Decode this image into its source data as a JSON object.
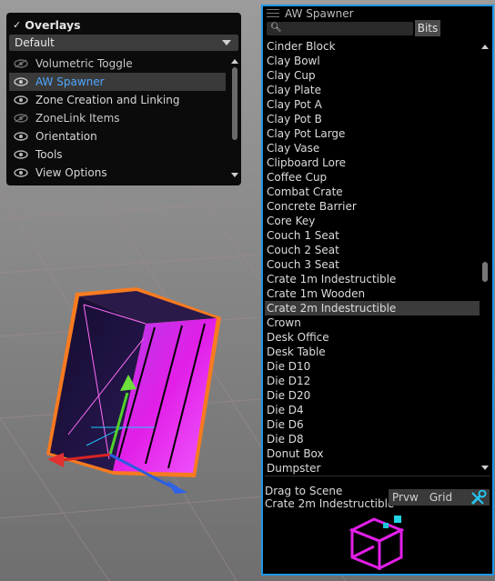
{
  "overlays": {
    "title": "Overlays",
    "check_glyph": "✓",
    "preset": "Default",
    "items": [
      {
        "label": "Volumetric Toggle",
        "visible": false,
        "selected": false
      },
      {
        "label": "AW Spawner",
        "visible": true,
        "selected": true
      },
      {
        "label": "Zone Creation and Linking",
        "visible": true,
        "selected": false
      },
      {
        "label": "ZoneLink Items",
        "visible": false,
        "selected": false
      },
      {
        "label": "Orientation",
        "visible": true,
        "selected": false
      },
      {
        "label": "Tools",
        "visible": true,
        "selected": false
      },
      {
        "label": "View Options",
        "visible": true,
        "selected": false
      }
    ]
  },
  "spawner": {
    "title": "AW Spawner",
    "search_value": "",
    "bits_label": "Bits",
    "items": [
      "Cinder Block",
      "Clay Bowl",
      "Clay Cup",
      "Clay Plate",
      "Clay Pot A",
      "Clay Pot B",
      "Clay Pot Large",
      "Clay Vase",
      "Clipboard Lore",
      "Coffee Cup",
      "Combat Crate",
      "Concrete Barrier",
      "Core Key",
      "Couch 1 Seat",
      "Couch 2 Seat",
      "Couch 3 Seat",
      "Crate 1m Indestructible",
      "Crate 1m Wooden",
      "Crate 2m Indestructible",
      "Crown",
      "Desk Office",
      "Desk Table",
      "Die D10",
      "Die D12",
      "Die D20",
      "Die D4",
      "Die D6",
      "Die D8",
      "Donut Box",
      "Dumpster"
    ],
    "selected_item": "Crate 2m Indestructible",
    "drag_hint": "Drag to Scene",
    "selected_name": "Crate 2m Indestructible",
    "preview_label": "Prvw",
    "grid_label": "Grid"
  },
  "colors": {
    "accent": "#1f97e6",
    "selected_text": "#4fa7ff",
    "crate_magenta": "#e21fe8",
    "outline_orange": "#ff7a1a"
  },
  "icons": {
    "overlay_check": "check-icon",
    "visibility": "eye-icon",
    "search": "search-icon",
    "tools": "wrench-icon"
  }
}
